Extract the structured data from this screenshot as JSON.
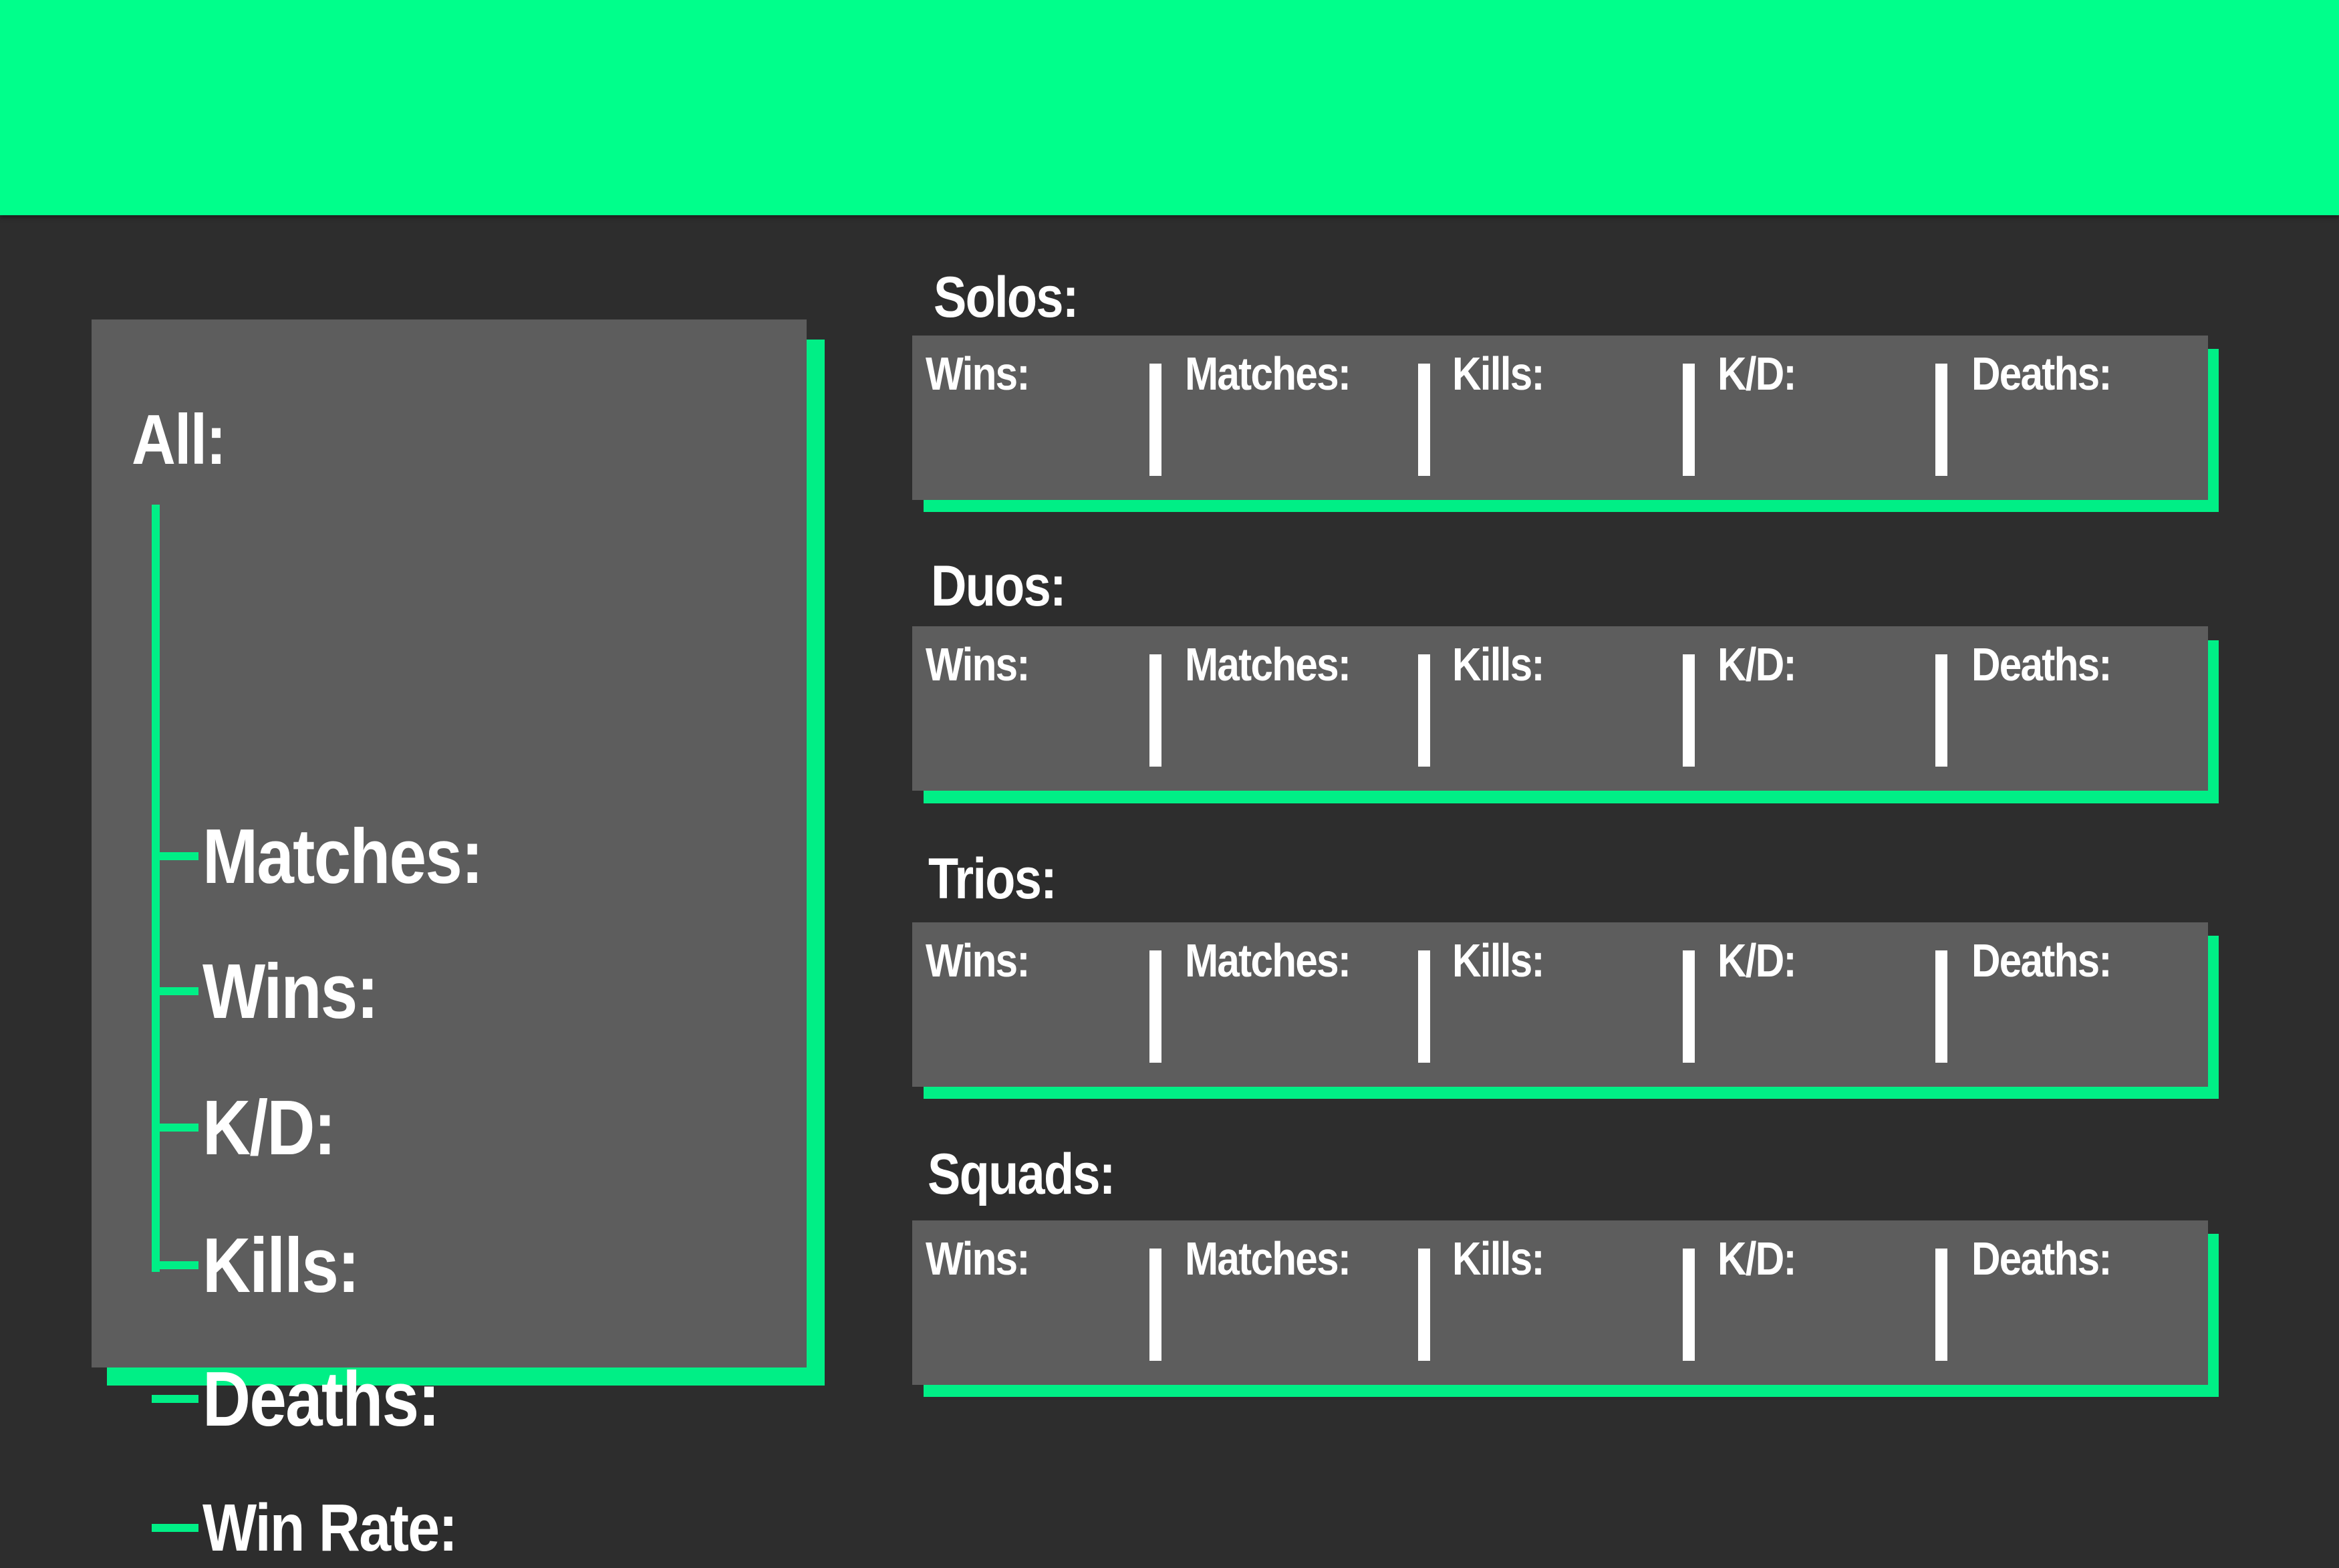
{
  "banner_color": "#00ff8b",
  "background_color": "#2d2d2d",
  "accent_color": "#00ef86",
  "panel_color": "#5d5d5d",
  "all": {
    "title": "All:",
    "items": [
      {
        "label": "Matches:"
      },
      {
        "label": "Wins:"
      },
      {
        "label": "K/D:"
      },
      {
        "label": "Kills:"
      },
      {
        "label": "Deaths:"
      },
      {
        "label": "Win Rate:"
      }
    ]
  },
  "modes": [
    {
      "title": "Solos:",
      "stats": [
        "Wins:",
        "Matches:",
        "Kills:",
        "K/D:",
        "Deaths:"
      ]
    },
    {
      "title": "Duos:",
      "stats": [
        "Wins:",
        "Matches:",
        "Kills:",
        "K/D:",
        "Deaths:"
      ]
    },
    {
      "title": "Trios:",
      "stats": [
        "Wins:",
        "Matches:",
        "Kills:",
        "K/D:",
        "Deaths:"
      ]
    },
    {
      "title": "Squads:",
      "stats": [
        "Wins:",
        "Matches:",
        "Kills:",
        "K/D:",
        "Deaths:"
      ]
    }
  ]
}
